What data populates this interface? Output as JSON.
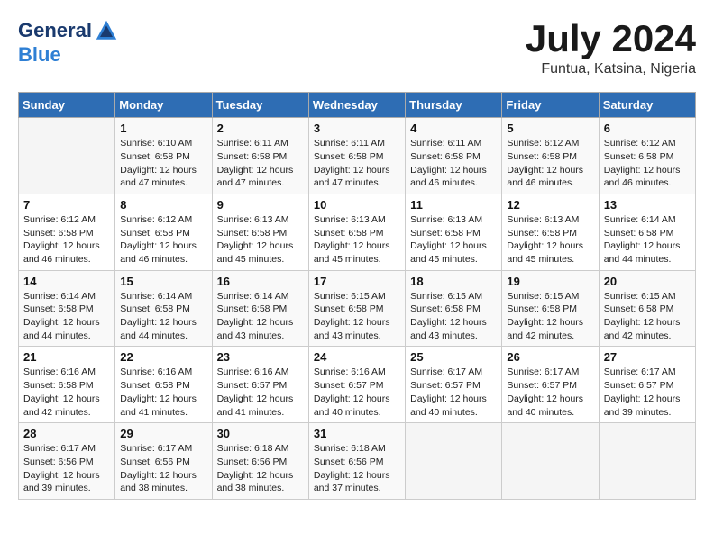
{
  "header": {
    "logo": {
      "general": "General",
      "blue": "Blue"
    },
    "title": "July 2024",
    "location": "Funtua, Katsina, Nigeria"
  },
  "calendar": {
    "days_of_week": [
      "Sunday",
      "Monday",
      "Tuesday",
      "Wednesday",
      "Thursday",
      "Friday",
      "Saturday"
    ],
    "weeks": [
      [
        {
          "day": "",
          "info": ""
        },
        {
          "day": "1",
          "info": "Sunrise: 6:10 AM\nSunset: 6:58 PM\nDaylight: 12 hours\nand 47 minutes."
        },
        {
          "day": "2",
          "info": "Sunrise: 6:11 AM\nSunset: 6:58 PM\nDaylight: 12 hours\nand 47 minutes."
        },
        {
          "day": "3",
          "info": "Sunrise: 6:11 AM\nSunset: 6:58 PM\nDaylight: 12 hours\nand 47 minutes."
        },
        {
          "day": "4",
          "info": "Sunrise: 6:11 AM\nSunset: 6:58 PM\nDaylight: 12 hours\nand 46 minutes."
        },
        {
          "day": "5",
          "info": "Sunrise: 6:12 AM\nSunset: 6:58 PM\nDaylight: 12 hours\nand 46 minutes."
        },
        {
          "day": "6",
          "info": "Sunrise: 6:12 AM\nSunset: 6:58 PM\nDaylight: 12 hours\nand 46 minutes."
        }
      ],
      [
        {
          "day": "7",
          "info": "Sunrise: 6:12 AM\nSunset: 6:58 PM\nDaylight: 12 hours\nand 46 minutes."
        },
        {
          "day": "8",
          "info": "Sunrise: 6:12 AM\nSunset: 6:58 PM\nDaylight: 12 hours\nand 46 minutes."
        },
        {
          "day": "9",
          "info": "Sunrise: 6:13 AM\nSunset: 6:58 PM\nDaylight: 12 hours\nand 45 minutes."
        },
        {
          "day": "10",
          "info": "Sunrise: 6:13 AM\nSunset: 6:58 PM\nDaylight: 12 hours\nand 45 minutes."
        },
        {
          "day": "11",
          "info": "Sunrise: 6:13 AM\nSunset: 6:58 PM\nDaylight: 12 hours\nand 45 minutes."
        },
        {
          "day": "12",
          "info": "Sunrise: 6:13 AM\nSunset: 6:58 PM\nDaylight: 12 hours\nand 45 minutes."
        },
        {
          "day": "13",
          "info": "Sunrise: 6:14 AM\nSunset: 6:58 PM\nDaylight: 12 hours\nand 44 minutes."
        }
      ],
      [
        {
          "day": "14",
          "info": "Sunrise: 6:14 AM\nSunset: 6:58 PM\nDaylight: 12 hours\nand 44 minutes."
        },
        {
          "day": "15",
          "info": "Sunrise: 6:14 AM\nSunset: 6:58 PM\nDaylight: 12 hours\nand 44 minutes."
        },
        {
          "day": "16",
          "info": "Sunrise: 6:14 AM\nSunset: 6:58 PM\nDaylight: 12 hours\nand 43 minutes."
        },
        {
          "day": "17",
          "info": "Sunrise: 6:15 AM\nSunset: 6:58 PM\nDaylight: 12 hours\nand 43 minutes."
        },
        {
          "day": "18",
          "info": "Sunrise: 6:15 AM\nSunset: 6:58 PM\nDaylight: 12 hours\nand 43 minutes."
        },
        {
          "day": "19",
          "info": "Sunrise: 6:15 AM\nSunset: 6:58 PM\nDaylight: 12 hours\nand 42 minutes."
        },
        {
          "day": "20",
          "info": "Sunrise: 6:15 AM\nSunset: 6:58 PM\nDaylight: 12 hours\nand 42 minutes."
        }
      ],
      [
        {
          "day": "21",
          "info": "Sunrise: 6:16 AM\nSunset: 6:58 PM\nDaylight: 12 hours\nand 42 minutes."
        },
        {
          "day": "22",
          "info": "Sunrise: 6:16 AM\nSunset: 6:58 PM\nDaylight: 12 hours\nand 41 minutes."
        },
        {
          "day": "23",
          "info": "Sunrise: 6:16 AM\nSunset: 6:57 PM\nDaylight: 12 hours\nand 41 minutes."
        },
        {
          "day": "24",
          "info": "Sunrise: 6:16 AM\nSunset: 6:57 PM\nDaylight: 12 hours\nand 40 minutes."
        },
        {
          "day": "25",
          "info": "Sunrise: 6:17 AM\nSunset: 6:57 PM\nDaylight: 12 hours\nand 40 minutes."
        },
        {
          "day": "26",
          "info": "Sunrise: 6:17 AM\nSunset: 6:57 PM\nDaylight: 12 hours\nand 40 minutes."
        },
        {
          "day": "27",
          "info": "Sunrise: 6:17 AM\nSunset: 6:57 PM\nDaylight: 12 hours\nand 39 minutes."
        }
      ],
      [
        {
          "day": "28",
          "info": "Sunrise: 6:17 AM\nSunset: 6:56 PM\nDaylight: 12 hours\nand 39 minutes."
        },
        {
          "day": "29",
          "info": "Sunrise: 6:17 AM\nSunset: 6:56 PM\nDaylight: 12 hours\nand 38 minutes."
        },
        {
          "day": "30",
          "info": "Sunrise: 6:18 AM\nSunset: 6:56 PM\nDaylight: 12 hours\nand 38 minutes."
        },
        {
          "day": "31",
          "info": "Sunrise: 6:18 AM\nSunset: 6:56 PM\nDaylight: 12 hours\nand 37 minutes."
        },
        {
          "day": "",
          "info": ""
        },
        {
          "day": "",
          "info": ""
        },
        {
          "day": "",
          "info": ""
        }
      ]
    ]
  }
}
